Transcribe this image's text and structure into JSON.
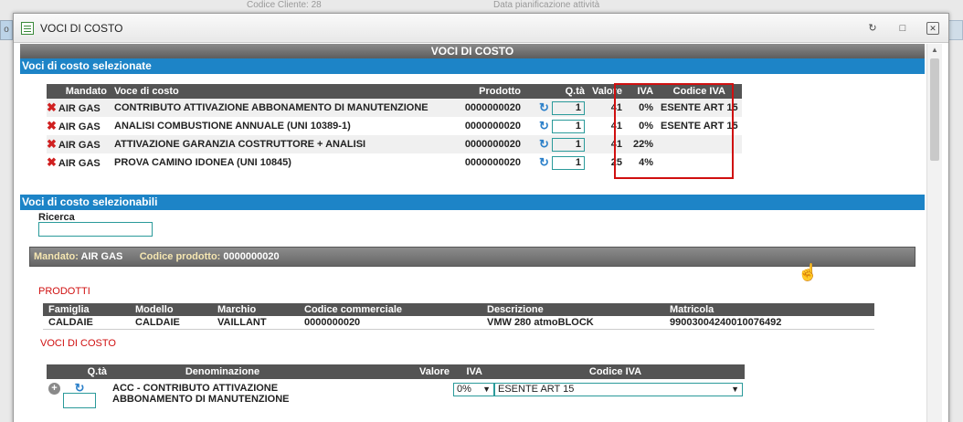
{
  "background": {
    "left_tab": "o",
    "text1": "Codice Cliente: 28",
    "text2": "Data pianificazione attività"
  },
  "dialog": {
    "title": "VOCI DI COSTO",
    "controls": [
      "refresh-icon",
      "maximize-icon",
      "close-icon"
    ],
    "main_header": "VOCI DI COSTO"
  },
  "selected": {
    "section_title": "Voci di costo selezionate",
    "columns": {
      "mandato": "Mandato",
      "voce": "Voce di costo",
      "prodotto": "Prodotto",
      "qta": "Q.tà",
      "valore": "Valore",
      "iva": "IVA",
      "codice_iva": "Codice IVA"
    },
    "rows": [
      {
        "mandato": "AIR GAS",
        "voce": "CONTRIBUTO ATTIVAZIONE ABBONAMENTO DI MANUTENZIONE",
        "prodotto": "0000000020",
        "qta": "1",
        "valore": "41",
        "iva": "0%",
        "codice_iva": "ESENTE ART 15"
      },
      {
        "mandato": "AIR GAS",
        "voce": "ANALISI COMBUSTIONE ANNUALE (UNI 10389-1)",
        "prodotto": "0000000020",
        "qta": "1",
        "valore": "41",
        "iva": "0%",
        "codice_iva": "ESENTE ART 15"
      },
      {
        "mandato": "AIR GAS",
        "voce": "ATTIVAZIONE GARANZIA COSTRUTTORE + ANALISI",
        "prodotto": "0000000020",
        "qta": "1",
        "valore": "41",
        "iva": "22%",
        "codice_iva": ""
      },
      {
        "mandato": "AIR GAS",
        "voce": "PROVA CAMINO IDONEA (UNI 10845)",
        "prodotto": "0000000020",
        "qta": "1",
        "valore": "25",
        "iva": "4%",
        "codice_iva": ""
      }
    ]
  },
  "selectable": {
    "section_title": "Voci di costo selezionabili",
    "search_label": "Ricerca",
    "search_value": "",
    "mandato_label": "Mandato:",
    "mandato_value": "AIR GAS",
    "codice_label": "Codice prodotto:",
    "codice_value": "0000000020",
    "prodotti_label": "PRODOTTI",
    "prodotti_columns": [
      "Famiglia",
      "Modello",
      "Marchio",
      "Codice commerciale",
      "Descrizione",
      "Matricola"
    ],
    "prodotti_rows": [
      [
        "CALDAIE",
        "CALDAIE",
        "VAILLANT",
        "0000000020",
        "VMW 280 atmoBLOCK",
        "99003004240010076492"
      ]
    ],
    "voci_label": "VOCI DI COSTO",
    "voci_columns": {
      "qta": "Q.tà",
      "denominazione": "Denominazione",
      "valore": "Valore",
      "iva": "IVA",
      "codice_iva": "Codice IVA"
    },
    "voci_rows": [
      {
        "denominazione": "ACC - CONTRIBUTO ATTIVAZIONE ABBONAMENTO DI MANUTENZIONE",
        "qta": "",
        "valore": "",
        "iva": "0%",
        "codice_iva": "ESENTE ART 15"
      }
    ]
  },
  "colors": {
    "section_blue": "#1d84c7",
    "header_gray": "#545454",
    "highlight_red": "#d01010",
    "delete_red": "#d02020",
    "refresh_blue": "#2a7fc9"
  }
}
